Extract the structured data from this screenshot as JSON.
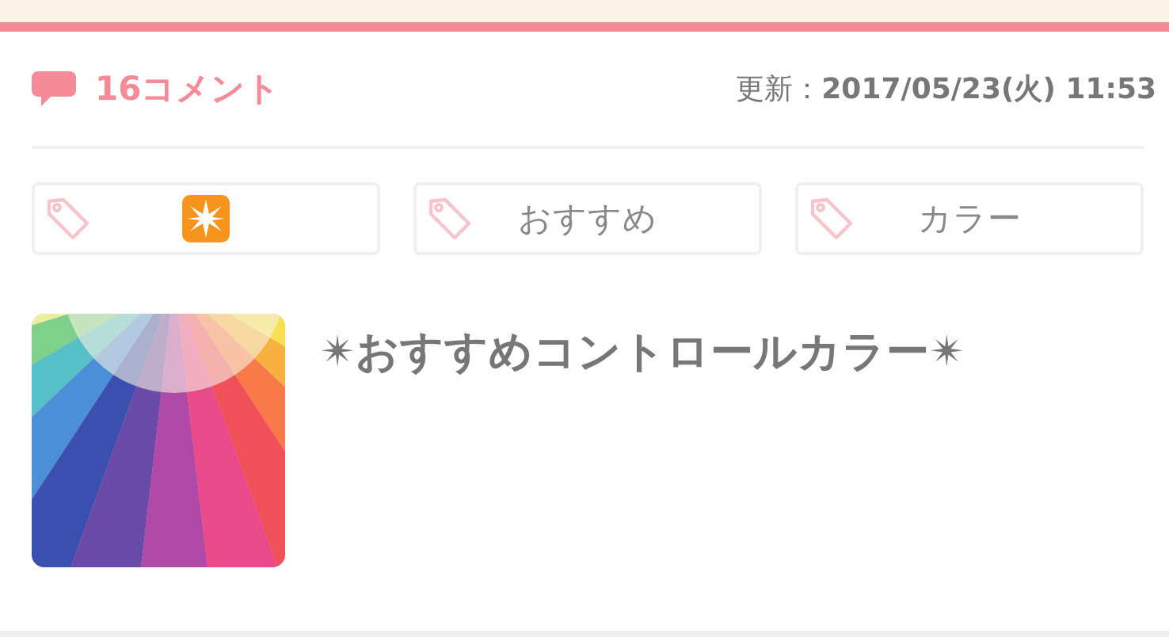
{
  "comments": {
    "label": "16コメント"
  },
  "updated": {
    "label": "更新：",
    "date": "2017/05/23(火) 11:53"
  },
  "tags": [
    {
      "kind": "emoji"
    },
    {
      "kind": "text",
      "label": "おすすめ"
    },
    {
      "kind": "text",
      "label": "カラー"
    }
  ],
  "article": {
    "title": "✴おすすめコントロールカラー✴"
  }
}
